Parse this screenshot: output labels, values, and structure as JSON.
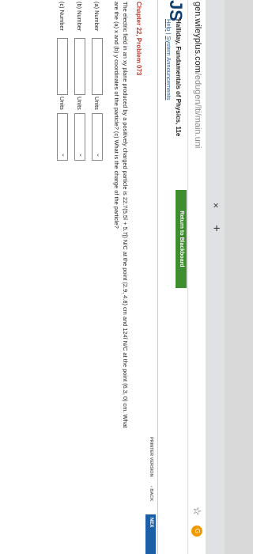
{
  "browser": {
    "tab_close": "×",
    "tab_new": "+",
    "url_host": "gen.wileyplus.com",
    "url_path": "/edugen/lti/main.uni",
    "star_icon": "☆",
    "extension_label": "G"
  },
  "header": {
    "logo": "JS",
    "course_title": "Halliday, Fundamentals of Physics, 11e",
    "help": "Help",
    "separator": "|",
    "announcements": "System Announcements",
    "return_button": "Return to Blackboard"
  },
  "nav": {
    "printer_version": "PRINTER VERSION",
    "back": "‹ BACK",
    "next": "NEX"
  },
  "problem": {
    "chapter": "Chapter 22, Problem 073",
    "line1": "The electric field in an xy plane produced by a positively charged particle is 22.7(5.5î + 5.7ĵ) N/C at the point (2.9, 4.8) cm and 124î N/C at the point (6.3, 0) cm. What",
    "line2": "are the (a) x and (b) y coordinates of the particle? (c) What is the charge of the particle?"
  },
  "answers": [
    {
      "label": "(a) Number",
      "units_label": "Units",
      "value": ""
    },
    {
      "label": "(b) Number",
      "units_label": "Units",
      "value": ""
    },
    {
      "label": "(c) Number",
      "units_label": "Units",
      "value": ""
    }
  ],
  "colors": {
    "return_button": "#3e8e2f",
    "chapter": "#c0392b",
    "next": "#1b5fa8"
  }
}
